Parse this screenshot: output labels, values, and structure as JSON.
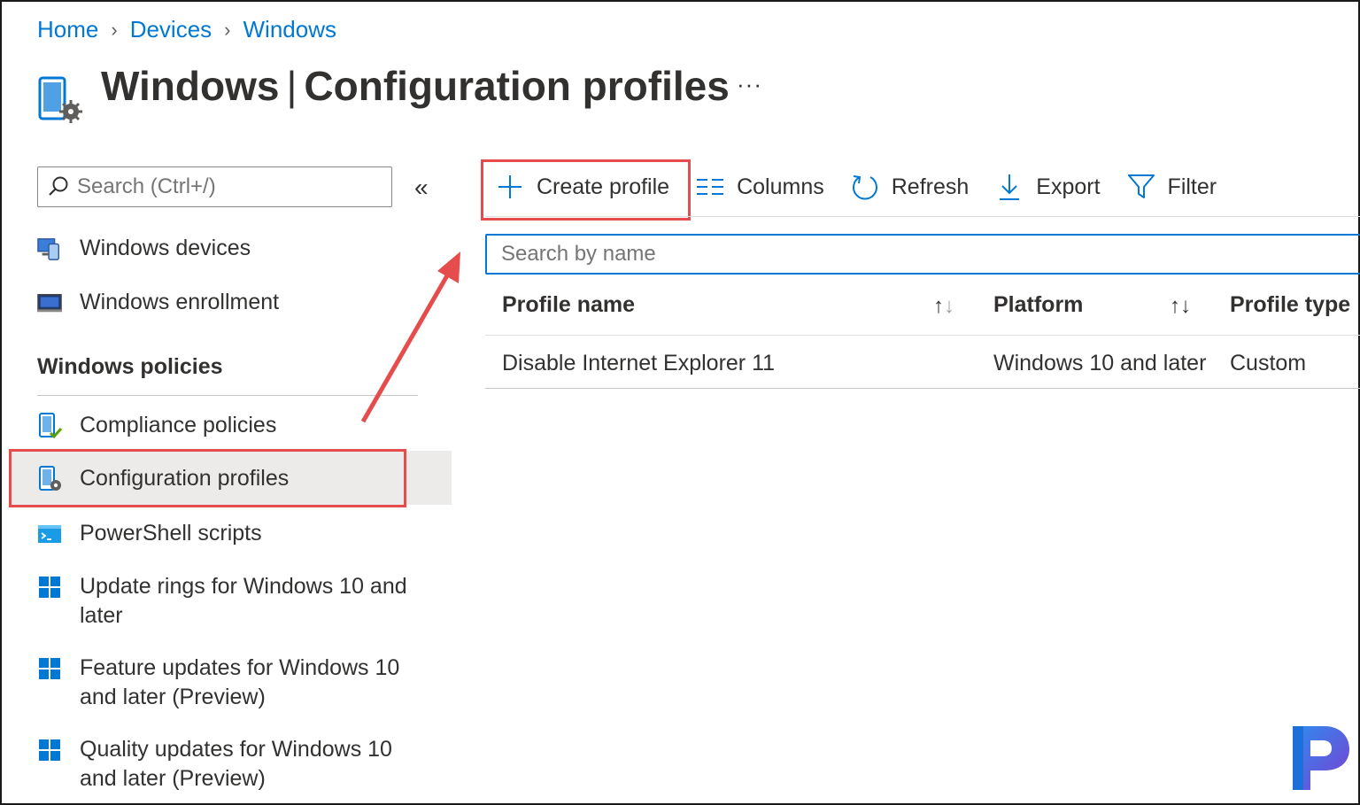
{
  "breadcrumb": [
    {
      "label": "Home"
    },
    {
      "label": "Devices"
    },
    {
      "label": "Windows"
    }
  ],
  "header": {
    "title_main": "Windows",
    "title_separator": "|",
    "title_sub": "Configuration profiles",
    "more_label": "···",
    "icon": "device-settings-icon"
  },
  "nav": {
    "search_placeholder": "Search (Ctrl+/)",
    "collapse_label": "«",
    "items_top": [
      {
        "label": "Windows devices",
        "icon": "windows-devices-icon"
      },
      {
        "label": "Windows enrollment",
        "icon": "enrollment-icon"
      }
    ],
    "section_title": "Windows policies",
    "items_policies": [
      {
        "label": "Compliance policies",
        "icon": "compliance-icon"
      },
      {
        "label": "Configuration profiles",
        "icon": "configuration-profile-icon",
        "selected": true
      },
      {
        "label": "PowerShell scripts",
        "icon": "powershell-icon"
      },
      {
        "label": "Update rings for Windows 10 and later",
        "icon": "windows-logo-icon"
      },
      {
        "label": "Feature updates for Windows 10 and later (Preview)",
        "icon": "windows-logo-icon"
      },
      {
        "label": "Quality updates for Windows 10 and later (Preview)",
        "icon": "windows-logo-icon"
      }
    ]
  },
  "toolbar": {
    "create_profile": "Create profile",
    "columns": "Columns",
    "refresh": "Refresh",
    "export": "Export",
    "filter": "Filter"
  },
  "list": {
    "search_placeholder": "Search by name",
    "columns": [
      "Profile name",
      "Platform",
      "Profile type"
    ],
    "rows": [
      {
        "profile_name": "Disable Internet Explorer 11",
        "platform": "Windows 10 and later",
        "profile_type": "Custom"
      }
    ]
  },
  "colors": {
    "accent": "#0078d4",
    "annotation": "#e74c4c",
    "selected_bg": "#edebe9",
    "text": "#323130"
  }
}
